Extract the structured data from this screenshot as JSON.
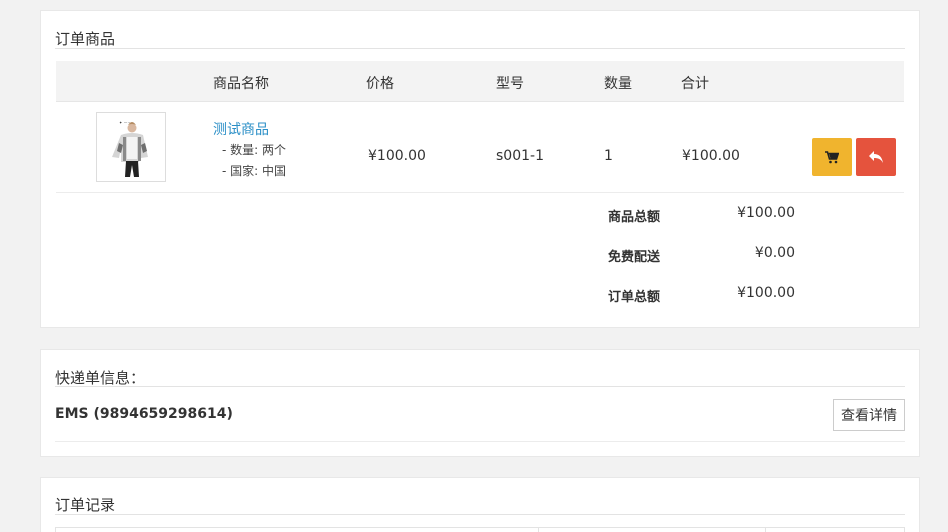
{
  "order": {
    "title": "订单商品",
    "columns": [
      "商品名称",
      "价格",
      "型号",
      "数量",
      "合计"
    ],
    "product": {
      "name": "测试商品",
      "options": [
        "- 数量: 两个",
        "- 国家: 中国"
      ],
      "price": "¥100.00",
      "model": "s001-1",
      "quantity": "1",
      "total": "¥100.00"
    },
    "actions": {
      "cart_icon": "shopping-cart-icon",
      "return_icon": "reply-icon"
    },
    "totals": [
      {
        "label": "商品总额",
        "value": "¥100.00"
      },
      {
        "label": "免费配送",
        "value": "¥0.00"
      },
      {
        "label": "订单总额",
        "value": "¥100.00"
      }
    ]
  },
  "shipping": {
    "title": "快递单信息：",
    "carrier": "EMS (9894659298614)",
    "detail_button": "查看详情"
  },
  "records": {
    "title": "订单记录"
  },
  "colors": {
    "background": "#f2f2f2",
    "link": "#2b8fc7",
    "cart_button": "#f0b42e",
    "return_button": "#e5533d"
  }
}
